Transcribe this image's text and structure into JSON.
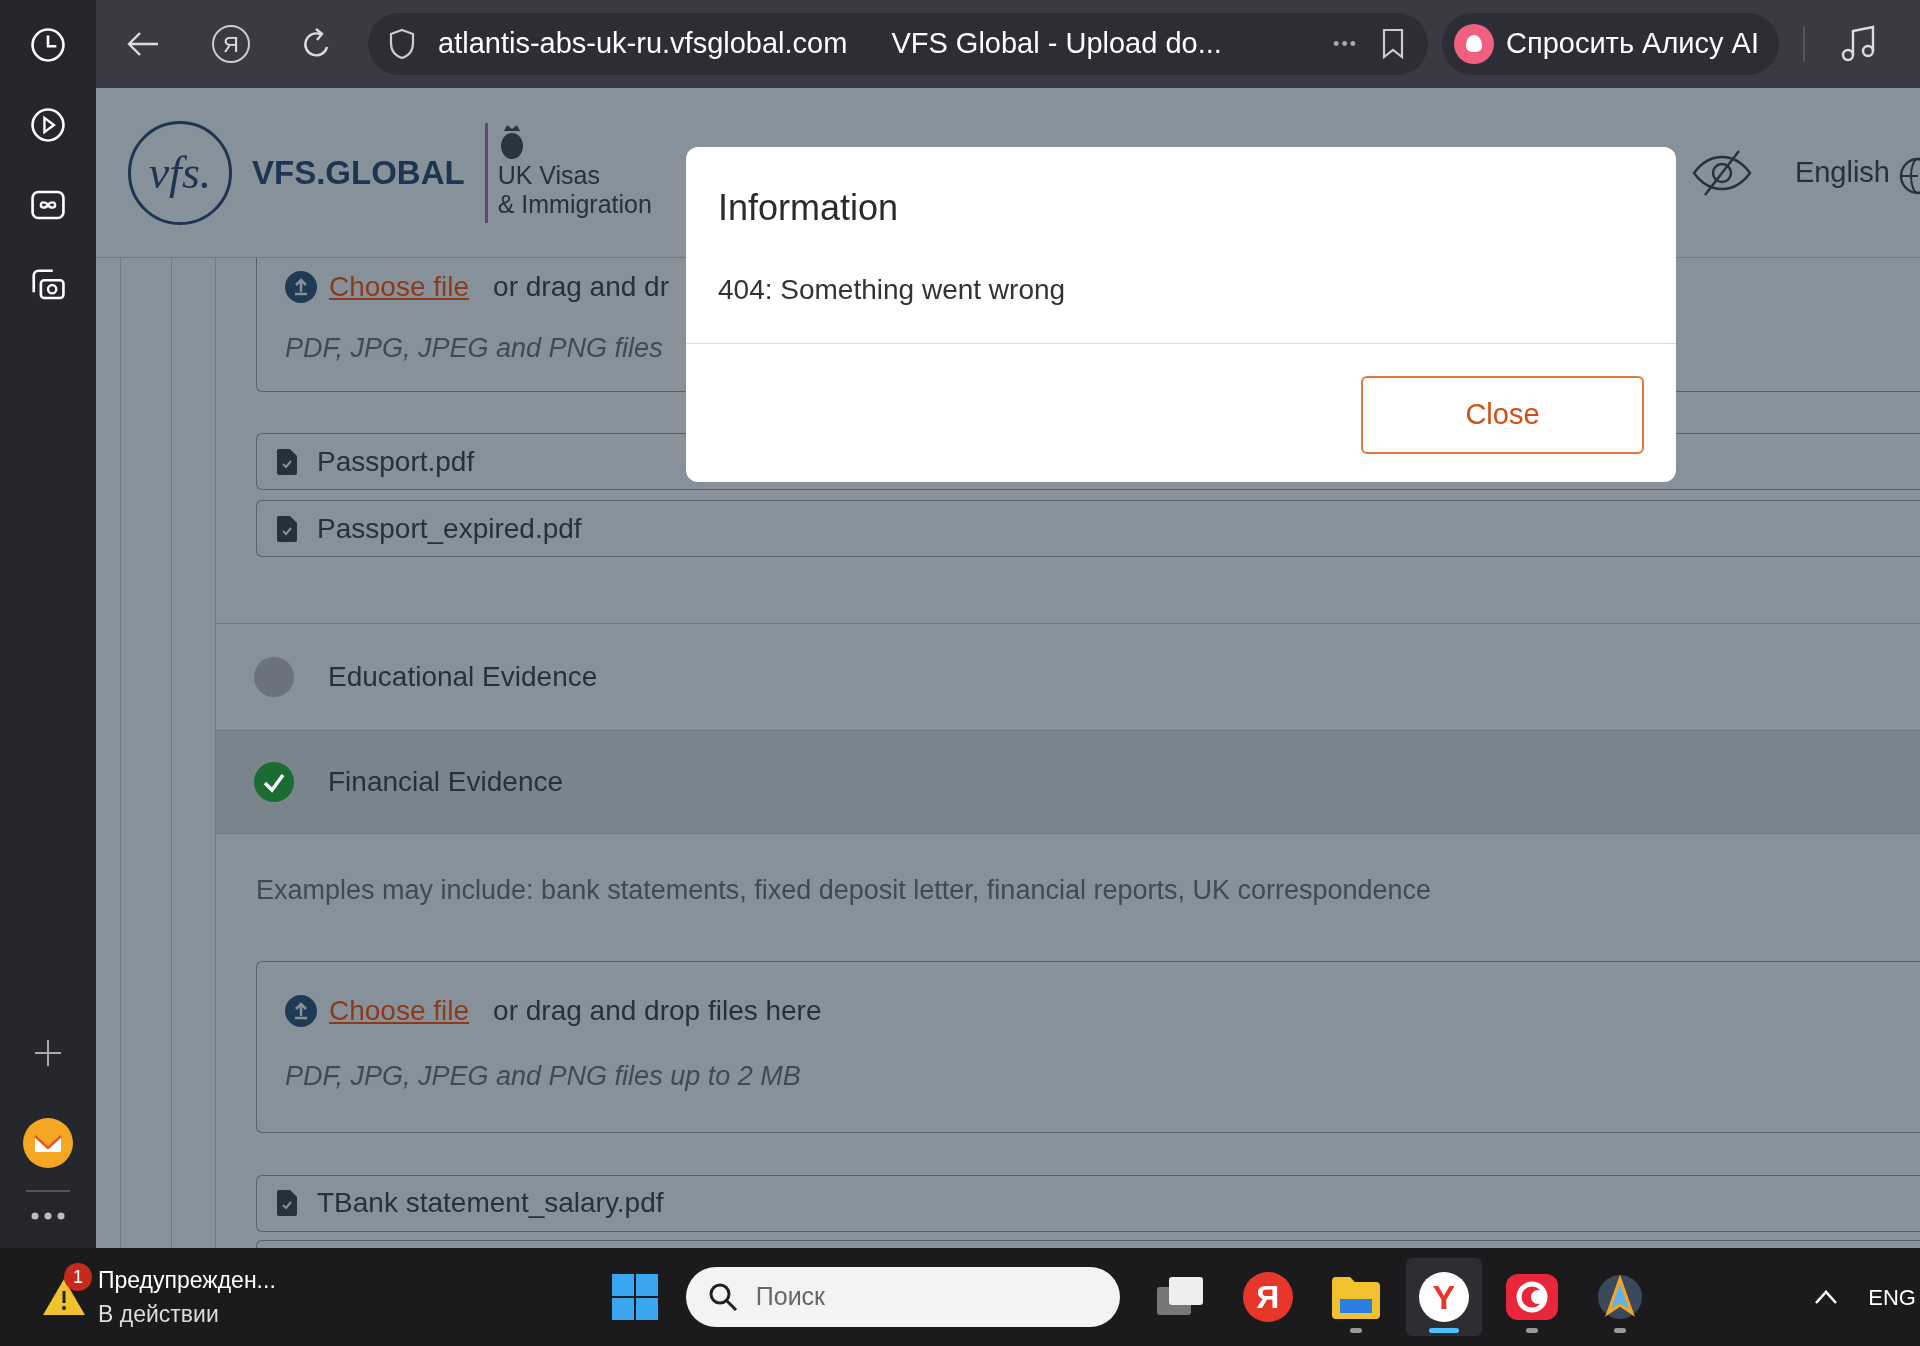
{
  "browser": {
    "yandex_button": "Я",
    "url": "atlantis-abs-uk-ru.vfsglobal.com",
    "tab_title": "VFS Global - Upload do...",
    "more_button": "•••",
    "assistant_button": "Спросить Алису AI"
  },
  "header": {
    "logo_mark": "vfs.",
    "brand": "VFS.GLOBAL",
    "partner_line_1": "UK Visas",
    "partner_line_2": "& Immigration",
    "language": "English"
  },
  "upper_upload": {
    "link": "Choose file",
    "text": "or drag and dr",
    "hint": "PDF, JPG, JPEG and PNG files",
    "files": [
      "Passport.pdf",
      "Passport_expired.pdf"
    ]
  },
  "categories": [
    {
      "label": "Educational Evidence",
      "complete": false,
      "expanded": false
    },
    {
      "label": "Financial Evidence",
      "complete": true,
      "expanded": true,
      "description": "Examples may include: bank statements, fixed deposit letter, financial reports, UK correspondence",
      "upload": {
        "link": "Choose file",
        "text": "or drag and drop files here",
        "hint": "PDF, JPG, JPEG and PNG files up to 2 MB"
      },
      "files": [
        "TBank statement_salary.pdf"
      ]
    }
  ],
  "modal": {
    "title": "Information",
    "message": "404: Something went wrong",
    "button": "Close"
  },
  "taskbar": {
    "notification": {
      "badge": "1",
      "title": "Предупрежден...",
      "subtitle": "В действии"
    },
    "search_placeholder": "Поиск",
    "apps": [
      {
        "kind": "stack",
        "running": false,
        "selected": false
      },
      {
        "kind": "ya",
        "label": "Я",
        "running": false,
        "selected": false
      },
      {
        "kind": "folder",
        "running": true,
        "selected": false
      },
      {
        "kind": "browser",
        "label": "Y",
        "running": true,
        "selected": true
      },
      {
        "kind": "ring",
        "running": true,
        "selected": false
      },
      {
        "kind": "compass",
        "running": true,
        "selected": false
      }
    ],
    "language": "ENG"
  }
}
